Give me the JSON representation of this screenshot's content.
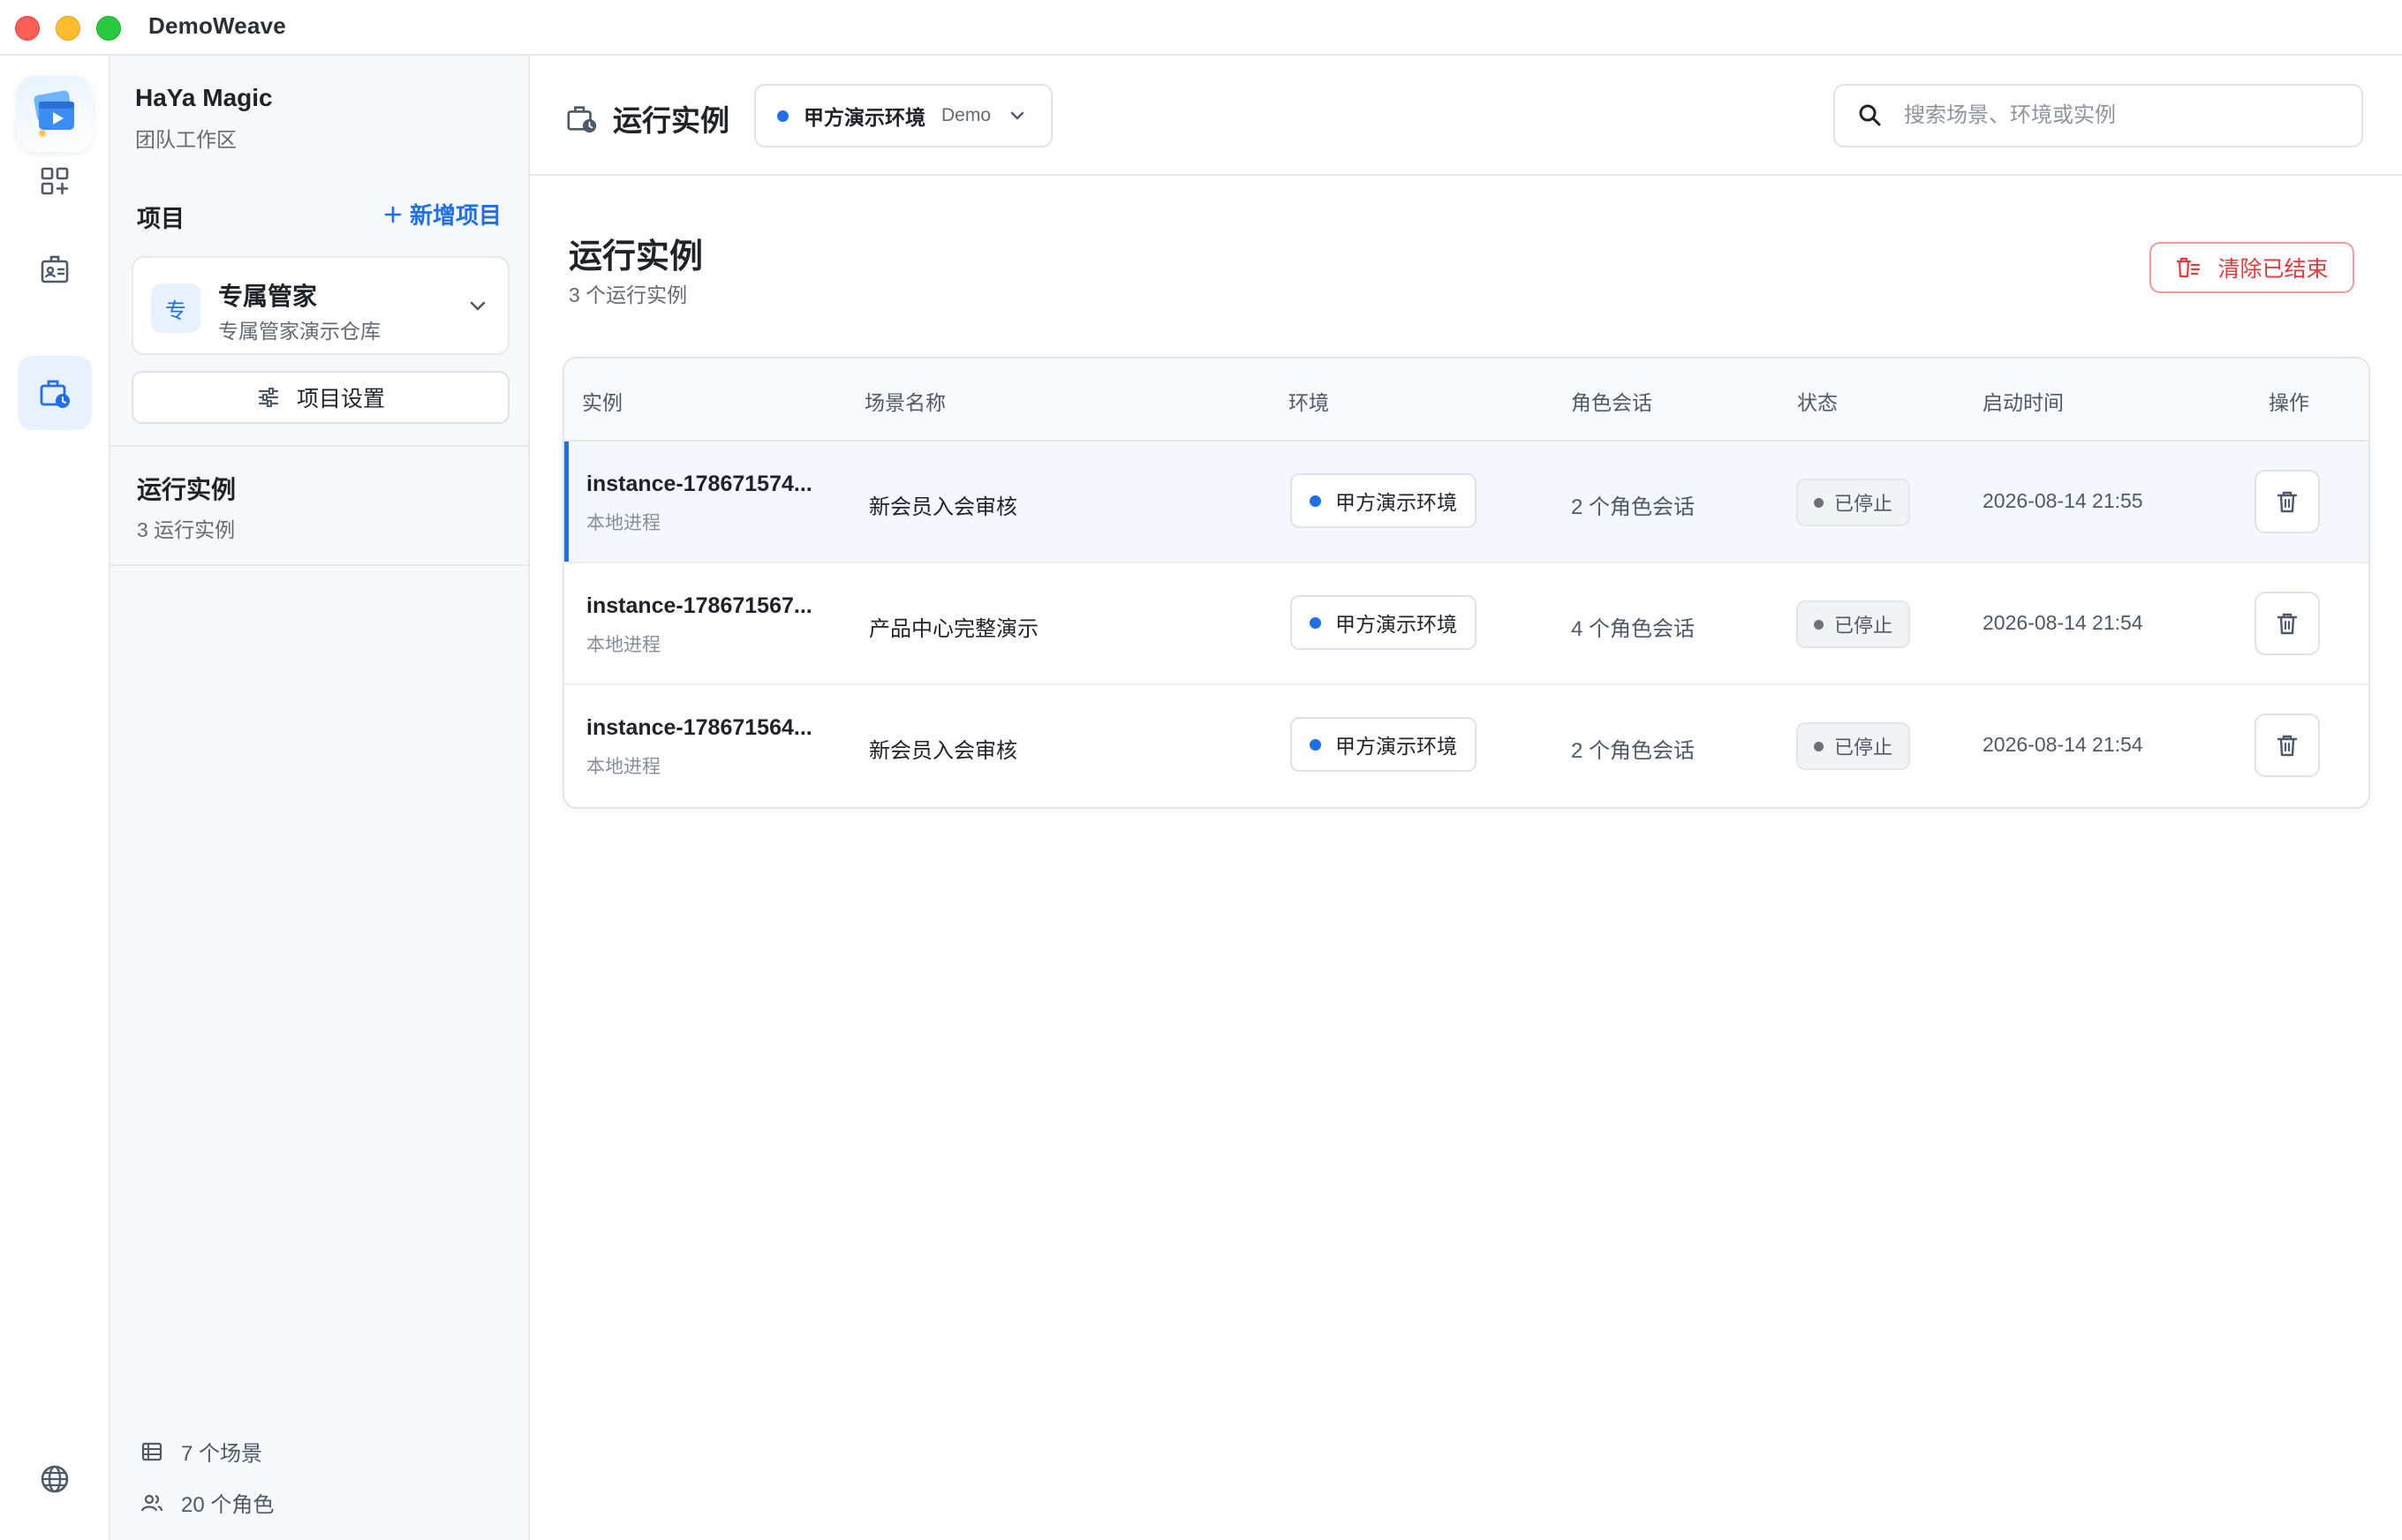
{
  "window": {
    "app_title": "DemoWeave"
  },
  "rail": {
    "items": [
      {
        "icon": "dashboard-add-icon"
      },
      {
        "icon": "roles-badge-icon"
      },
      {
        "icon": "running-instances-icon",
        "active": true
      }
    ],
    "bottom_icon": "globe-icon"
  },
  "sidebar": {
    "workspace_name": "HaYa Magic",
    "workspace_sub": "团队工作区",
    "projects_label": "项目",
    "add_project_label": "新增项目",
    "project": {
      "avatar": "专",
      "title": "专属管家",
      "desc": "专属管家演示仓库"
    },
    "settings_label": "项目设置",
    "nav": {
      "title": "运行实例",
      "sub": "3 运行实例"
    },
    "stats": {
      "scenes": "7 个场景",
      "roles": "20 个角色"
    }
  },
  "header": {
    "title": "运行实例",
    "env": {
      "name": "甲方演示环境",
      "tag": "Demo"
    },
    "search_placeholder": "搜索场景、环境或实例"
  },
  "page": {
    "title": "运行实例",
    "sub": "3 个运行实例",
    "clear_label": "清除已结束"
  },
  "table": {
    "headers": {
      "instance": "实例",
      "scene": "场景名称",
      "env": "环境",
      "sessions": "角色会话",
      "status": "状态",
      "started": "启动时间",
      "actions": "操作"
    },
    "rows": [
      {
        "id": "instance-178671574...",
        "type": "本地进程",
        "scene": "新会员入会审核",
        "env": "甲方演示环境",
        "sessions": "2 个角色会话",
        "status": "已停止",
        "started": "2026-08-14 21:55"
      },
      {
        "id": "instance-178671567...",
        "type": "本地进程",
        "scene": "产品中心完整演示",
        "env": "甲方演示环境",
        "sessions": "4 个角色会话",
        "status": "已停止",
        "started": "2026-08-14 21:54"
      },
      {
        "id": "instance-178671564...",
        "type": "本地进程",
        "scene": "新会员入会审核",
        "env": "甲方演示环境",
        "sessions": "2 个角色会话",
        "status": "已停止",
        "started": "2026-08-14 21:54"
      }
    ]
  },
  "colors": {
    "accent": "#1f6fea",
    "danger": "#e5383b",
    "selected_row": "#f4f7fc"
  }
}
